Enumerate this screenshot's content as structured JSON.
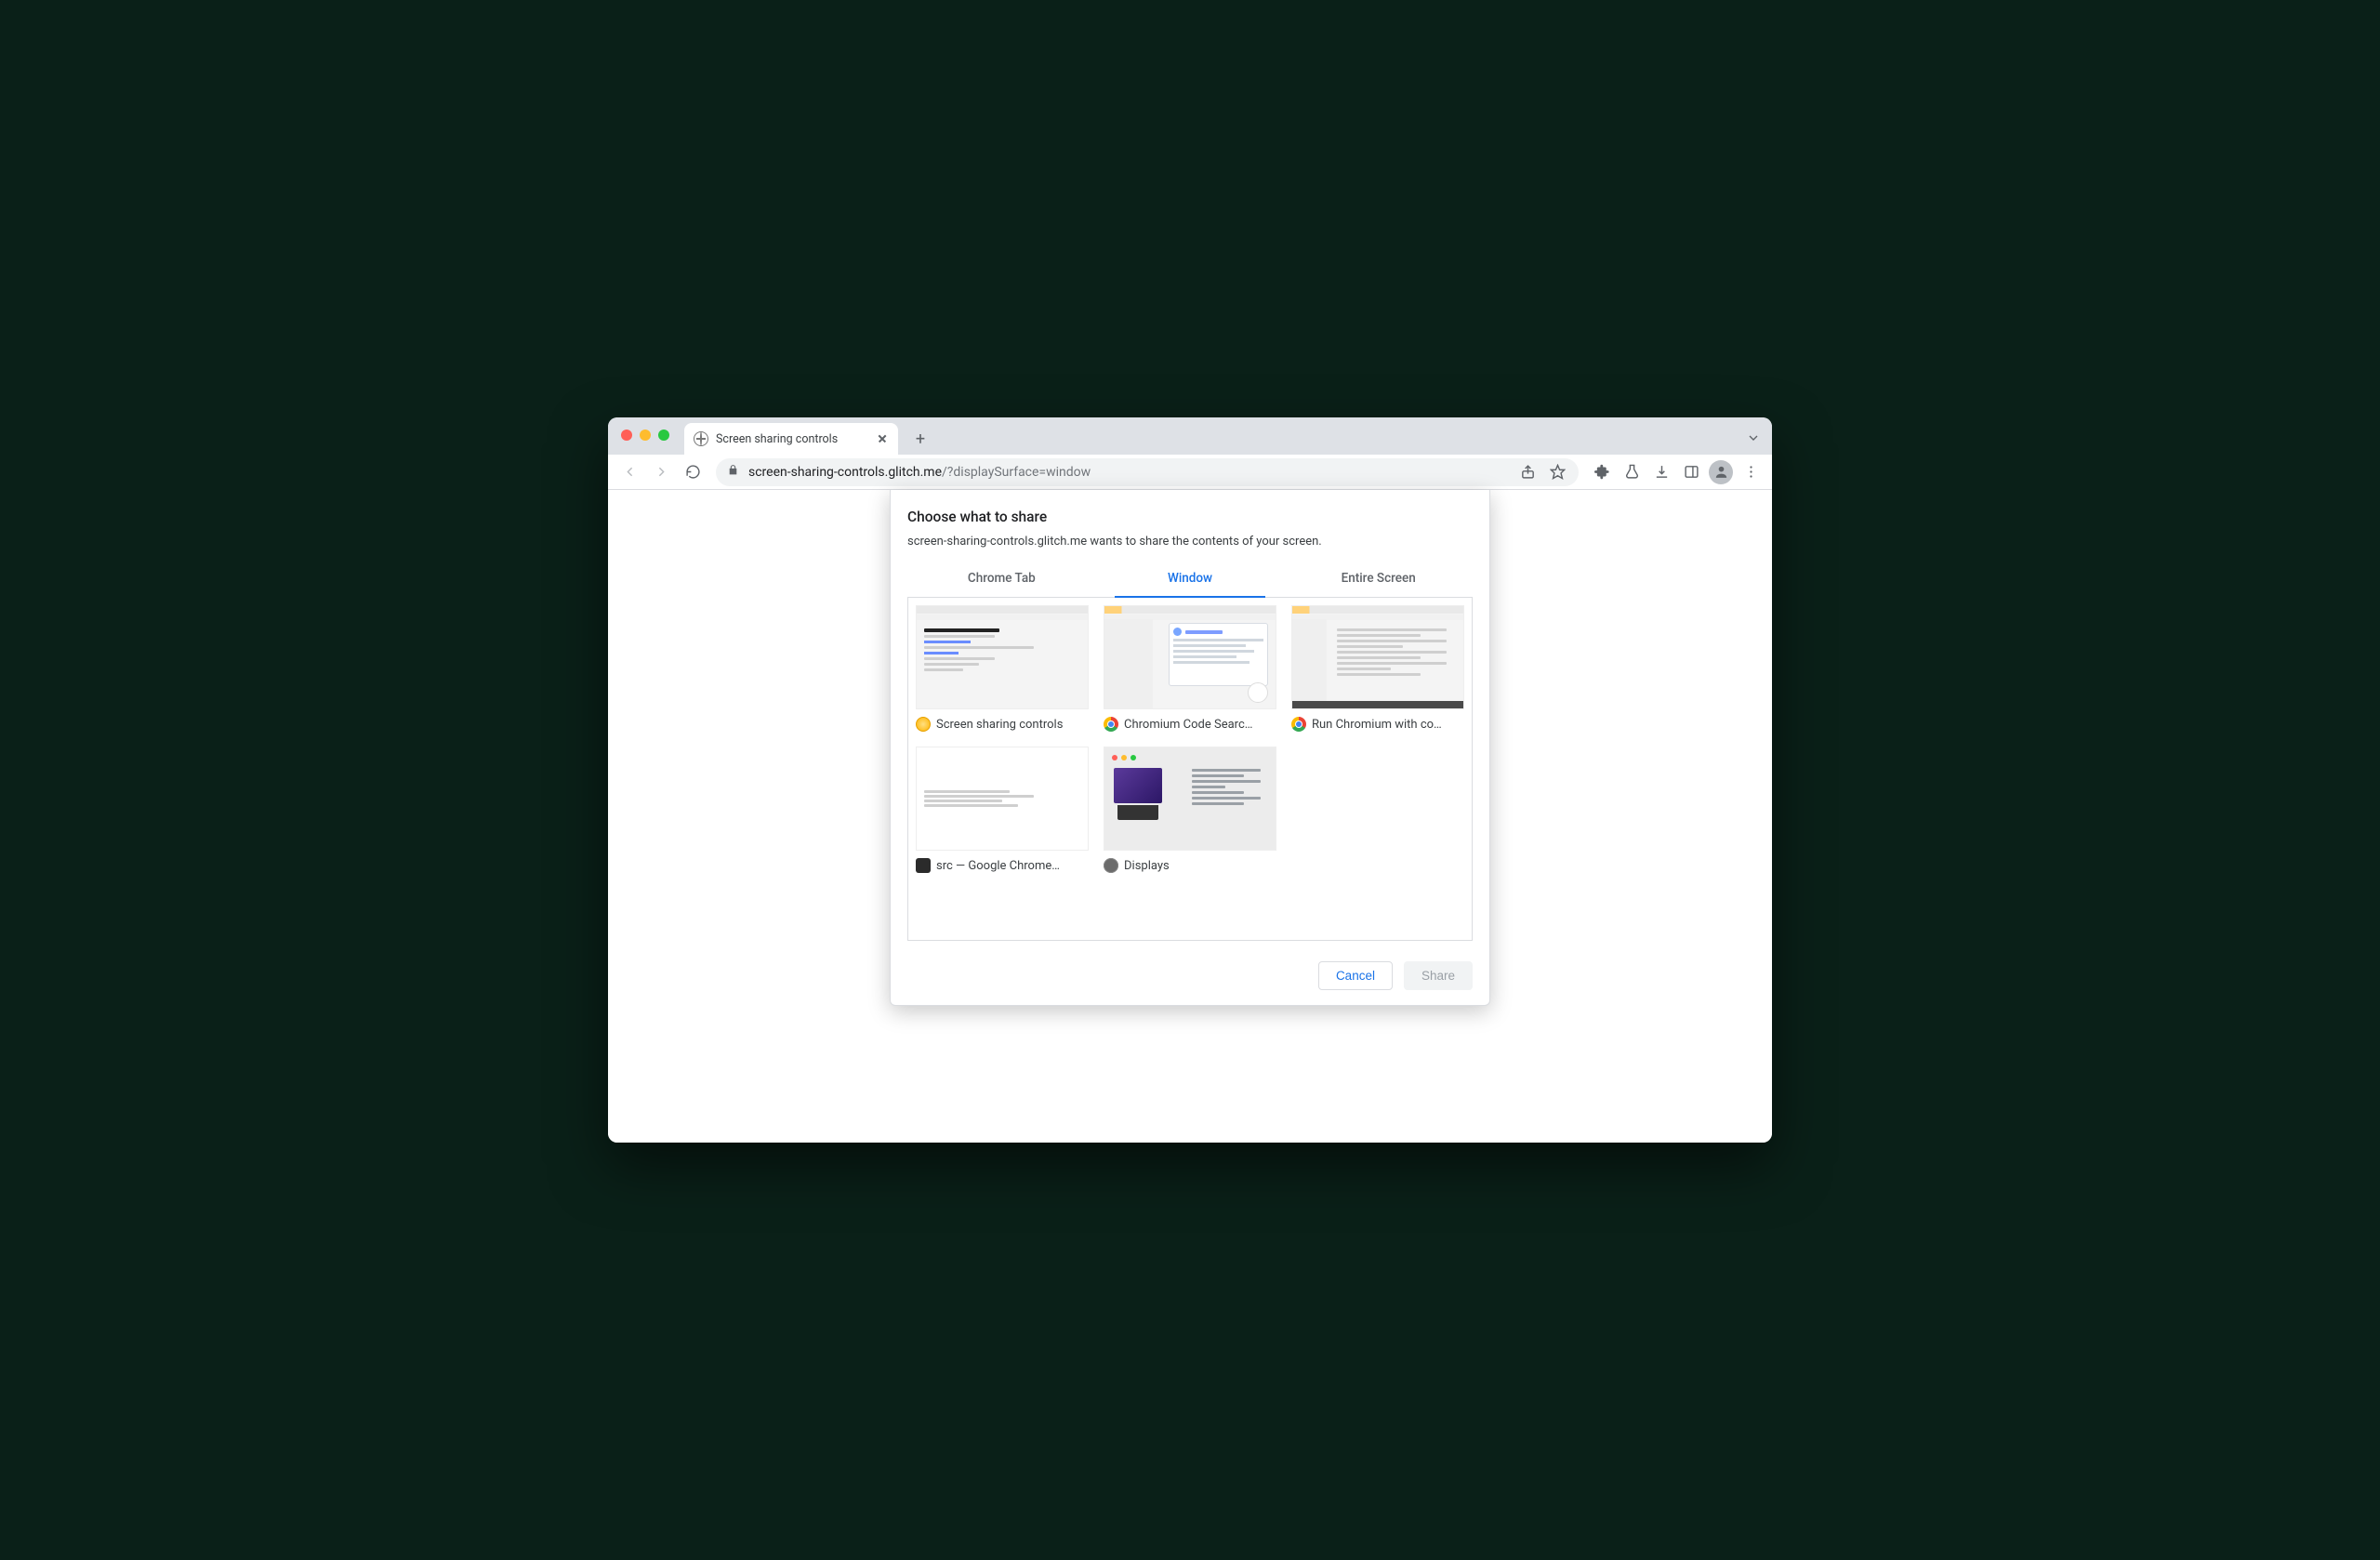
{
  "browser_tab": {
    "title": "Screen sharing controls"
  },
  "address_bar": {
    "host": "screen-sharing-controls.glitch.me",
    "path": "/?displaySurface=window"
  },
  "dialog": {
    "title": "Choose what to share",
    "subtitle": "screen-sharing-controls.glitch.me wants to share the contents of your screen.",
    "tabs": {
      "chrome_tab": "Chrome Tab",
      "window": "Window",
      "entire_screen": "Entire Screen",
      "active": "window"
    },
    "items": [
      {
        "label": "Screen sharing controls",
        "icon": "canary"
      },
      {
        "label": "Chromium Code Searc…",
        "icon": "chrome"
      },
      {
        "label": "Run Chromium with co…",
        "icon": "chrome"
      },
      {
        "label": "src — Google Chrome…",
        "icon": "terminal"
      },
      {
        "label": "Displays",
        "icon": "system"
      }
    ],
    "actions": {
      "cancel": "Cancel",
      "share": "Share"
    }
  }
}
